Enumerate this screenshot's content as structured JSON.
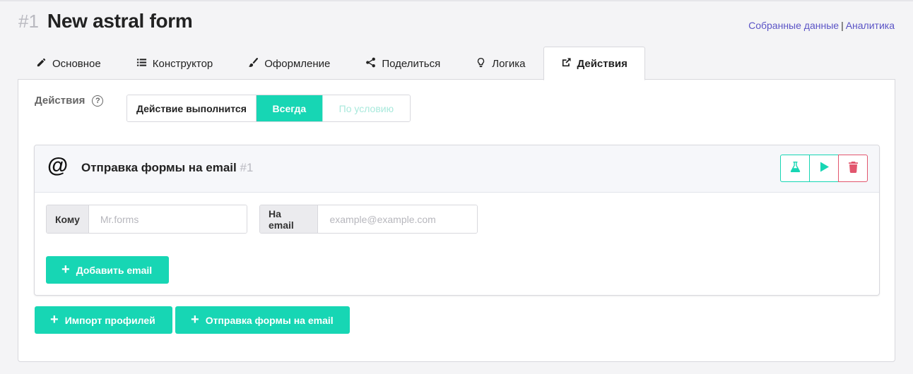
{
  "header": {
    "form_number": "#1",
    "form_name": "New astral form",
    "links": [
      "Собранные данные",
      "Аналитика"
    ],
    "separator": "|"
  },
  "tabs": [
    {
      "label": "Основное",
      "icon": "pencil-icon",
      "active": false
    },
    {
      "label": "Конструктор",
      "icon": "list-icon",
      "active": false
    },
    {
      "label": "Оформление",
      "icon": "brush-icon",
      "active": false
    },
    {
      "label": "Поделиться",
      "icon": "share-icon",
      "active": false
    },
    {
      "label": "Логика",
      "icon": "lightbulb-icon",
      "active": false
    },
    {
      "label": "Действия",
      "icon": "external-link-icon",
      "active": true
    }
  ],
  "actions": {
    "label": "Действия",
    "help_icon": "?",
    "segment_label": "Действие выполнится",
    "options": [
      "Всегда",
      "По условию"
    ],
    "selected": "Всегда"
  },
  "card": {
    "icon": "@",
    "title": "Отправка формы на email",
    "number": "#1",
    "buttons": [
      "flask-icon",
      "play-icon",
      "trash-icon"
    ],
    "to_label": "Кому",
    "to_placeholder": "Mr.forms",
    "email_label": "На email",
    "email_placeholder": "example@example.com",
    "add_email_label": "Добавить email"
  },
  "bottom_buttons": {
    "import_label": "Импорт профилей",
    "send_label": "Отправка формы на email"
  },
  "colors": {
    "accent": "#17d6b4",
    "danger": "#e2566e",
    "link": "#5b54c6"
  }
}
